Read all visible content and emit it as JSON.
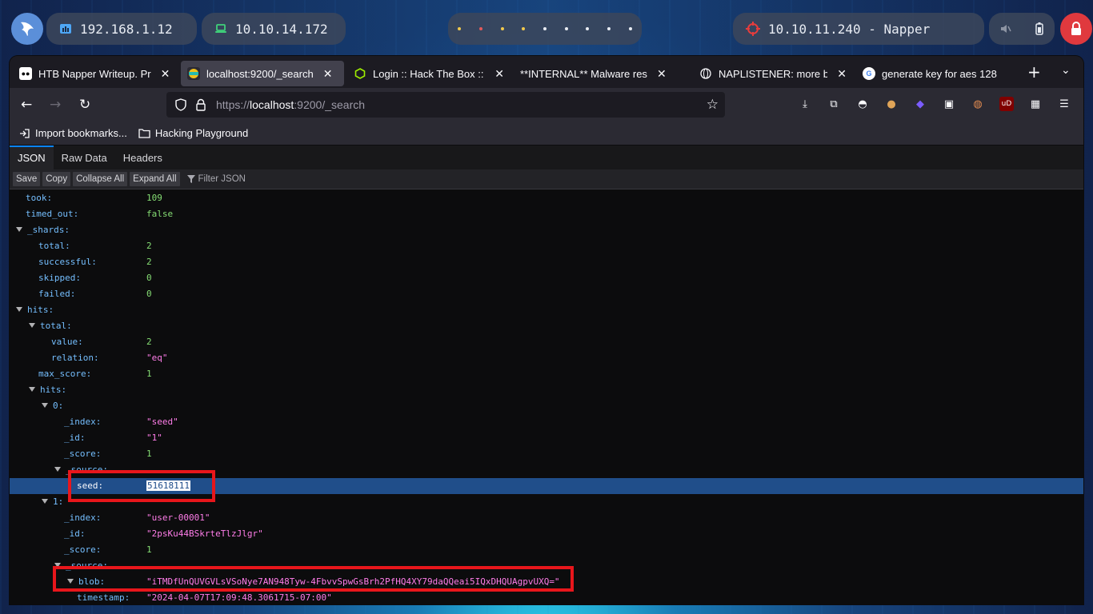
{
  "panel": {
    "ip_local": "192.168.1.12",
    "ip_vpn": "10.10.14.172",
    "target": "10.10.11.240 - Napper",
    "workspace_dot_colors": [
      "#f2c94c",
      "#e35a5a",
      "#f2c94c",
      "#f2c94c",
      "#e8ecf3",
      "#e8ecf3",
      "#e8ecf3",
      "#e8ecf3",
      "#e8ecf3"
    ]
  },
  "browser": {
    "tabs": [
      {
        "label": "HTB Napper Writeup. Pr",
        "icon": "medium-icon"
      },
      {
        "label": "localhost:9200/_search",
        "icon": "elastic-icon",
        "active": true
      },
      {
        "label": "Login :: Hack The Box :: H",
        "icon": "htb-cube-icon"
      },
      {
        "label": "**INTERNAL** Malware res",
        "icon": ""
      },
      {
        "label": "NAPLISTENER: more bac",
        "icon": "globe-icon"
      },
      {
        "label": "generate key for aes 128",
        "icon": "google-icon"
      }
    ],
    "url_prefix": "https://",
    "url_host": "localhost",
    "url_rest": ":9200/_search",
    "bookmarks": [
      {
        "label": "Import bookmarks...",
        "icon": "import-icon"
      },
      {
        "label": "Hacking Playground",
        "icon": "folder-icon"
      }
    ]
  },
  "viewer": {
    "tabs": [
      "JSON",
      "Raw Data",
      "Headers"
    ],
    "toolbar": [
      "Save",
      "Copy",
      "Collapse All",
      "Expand All"
    ],
    "filter_placeholder": "Filter JSON",
    "rows": [
      {
        "key": "took:",
        "indent": 0,
        "value": "109",
        "type": "num"
      },
      {
        "key": "timed_out:",
        "indent": 0,
        "value": "false",
        "type": "bool"
      },
      {
        "key": "_shards:",
        "indent": 0,
        "expander": true
      },
      {
        "key": "total:",
        "indent": 1,
        "value": "2",
        "type": "num"
      },
      {
        "key": "successful:",
        "indent": 1,
        "value": "2",
        "type": "num"
      },
      {
        "key": "skipped:",
        "indent": 1,
        "value": "0",
        "type": "num"
      },
      {
        "key": "failed:",
        "indent": 1,
        "value": "0",
        "type": "num"
      },
      {
        "key": "hits:",
        "indent": 0,
        "expander": true
      },
      {
        "key": "total:",
        "indent": 1,
        "expander": true
      },
      {
        "key": "value:",
        "indent": 2,
        "value": "2",
        "type": "num"
      },
      {
        "key": "relation:",
        "indent": 2,
        "value": "\"eq\"",
        "type": "str"
      },
      {
        "key": "max_score:",
        "indent": 1,
        "value": "1",
        "type": "num"
      },
      {
        "key": "hits:",
        "indent": 1,
        "expander": true
      },
      {
        "key": "0:",
        "indent": 2,
        "expander": true
      },
      {
        "key": "_index:",
        "indent": 3,
        "value": "\"seed\"",
        "type": "str"
      },
      {
        "key": "_id:",
        "indent": 3,
        "value": "\"1\"",
        "type": "str"
      },
      {
        "key": "_score:",
        "indent": 3,
        "value": "1",
        "type": "num"
      },
      {
        "key": "_source:",
        "indent": 3,
        "expander": true
      },
      {
        "key": "seed:",
        "indent": 4,
        "value": "51618111",
        "type": "num",
        "selected": true
      },
      {
        "key": "1:",
        "indent": 2,
        "expander": true
      },
      {
        "key": "_index:",
        "indent": 3,
        "value": "\"user-00001\"",
        "type": "str"
      },
      {
        "key": "_id:",
        "indent": 3,
        "value": "\"2psKu44BSkrteTlzJlgr\"",
        "type": "str"
      },
      {
        "key": "_score:",
        "indent": 3,
        "value": "1",
        "type": "num"
      },
      {
        "key": "_source:",
        "indent": 3,
        "expander": true
      },
      {
        "key": "blob:",
        "indent": 4,
        "expander": true,
        "value": "\"iTMDfUnQUVGVLsVSoNye7AN948Tyw-4FbvvSpwGsBrh2PfHQ4XY79daQQeai5IQxDHQUAgpvUXQ=\"",
        "type": "str"
      },
      {
        "key": "timestamp:",
        "indent": 4,
        "value": "\"2024-04-07T17:09:48.3061715-07:00\"",
        "type": "str"
      }
    ]
  }
}
